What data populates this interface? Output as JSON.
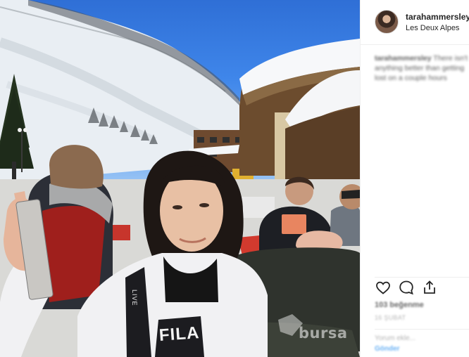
{
  "post": {
    "username": "tarahammersley",
    "location": "Les Deux Alpes",
    "caption_username": "tarahammersley",
    "caption_text": "There isn't anything better than getting lost on a couple hours",
    "likes": "103 beğenme",
    "time_ago": "16 ŞUBAT",
    "comment_placeholder": "Yorum ekle...",
    "comment_post_label": "Gönder"
  },
  "photo": {
    "shirt_text": "FILA",
    "strap_text": "LIVE"
  },
  "watermark": {
    "text": "bursa"
  },
  "icons": {
    "like": "heart-icon",
    "comment": "comment-icon",
    "share": "share-icon"
  }
}
